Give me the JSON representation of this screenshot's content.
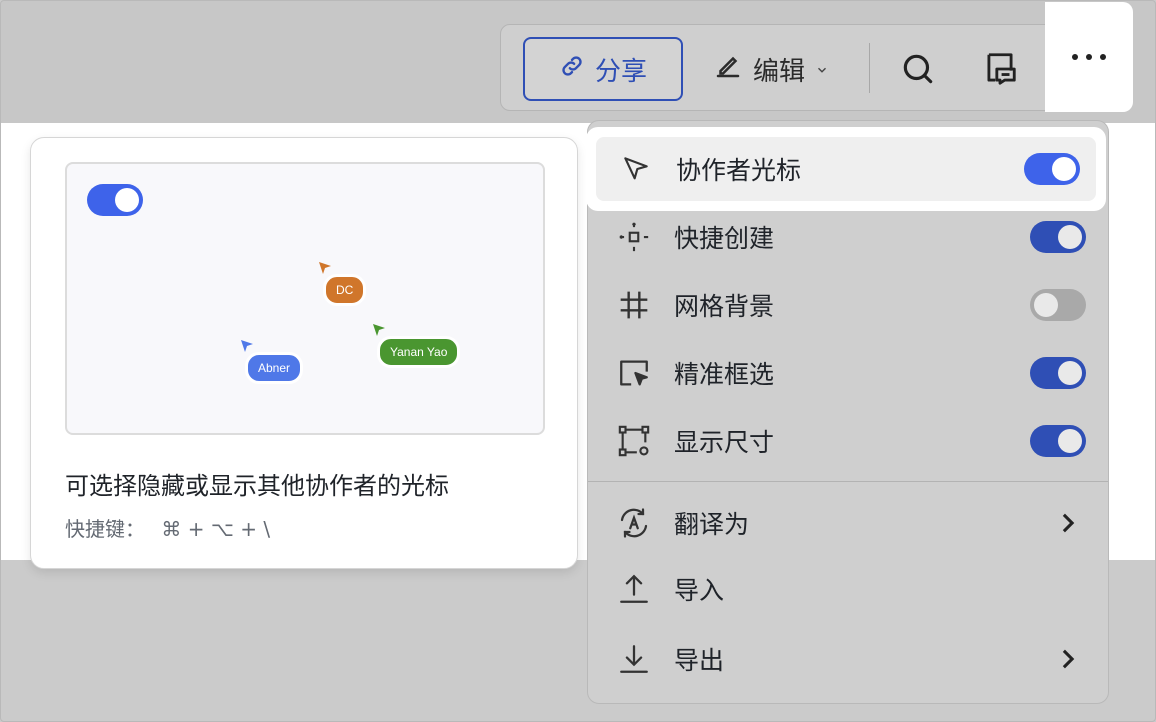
{
  "toolbar": {
    "share_label": "分享",
    "edit_label": "编辑",
    "icons": {
      "share": "link-icon",
      "edit": "pen-icon",
      "edit_caret": "chevron-down-icon",
      "search": "search-icon",
      "comment": "comment-icon",
      "more": "more-horizontal-icon"
    }
  },
  "preview_card": {
    "cursors": [
      {
        "name": "DC",
        "color": "#d0762b"
      },
      {
        "name": "Yanan Yao",
        "color": "#4a9630"
      },
      {
        "name": "Abner",
        "color": "#4f78e8"
      }
    ],
    "description": "可选择隐藏或显示其他协作者的光标",
    "shortcut_label": "快捷键：",
    "shortcut_keys": "⌘ + ⌥ + \\"
  },
  "menu": {
    "items": [
      {
        "label": "协作者光标",
        "icon": "cursor-pointer-icon",
        "toggle": true
      },
      {
        "label": "快捷创建",
        "icon": "quick-create-icon",
        "toggle": true
      },
      {
        "label": "网格背景",
        "icon": "grid-icon",
        "toggle": false
      },
      {
        "label": "精准框选",
        "icon": "box-select-icon",
        "toggle": true
      },
      {
        "label": "显示尺寸",
        "icon": "dimension-icon",
        "toggle": true
      },
      {
        "label": "翻译为",
        "icon": "translate-icon",
        "submenu": true
      },
      {
        "label": "导入",
        "icon": "upload-icon"
      },
      {
        "label": "导出",
        "icon": "download-icon",
        "submenu": true
      }
    ]
  },
  "colors": {
    "accent": "#2f4fb5",
    "toggle_on_bright": "#3e63ea",
    "toggle_off": "#a9a9a9"
  }
}
